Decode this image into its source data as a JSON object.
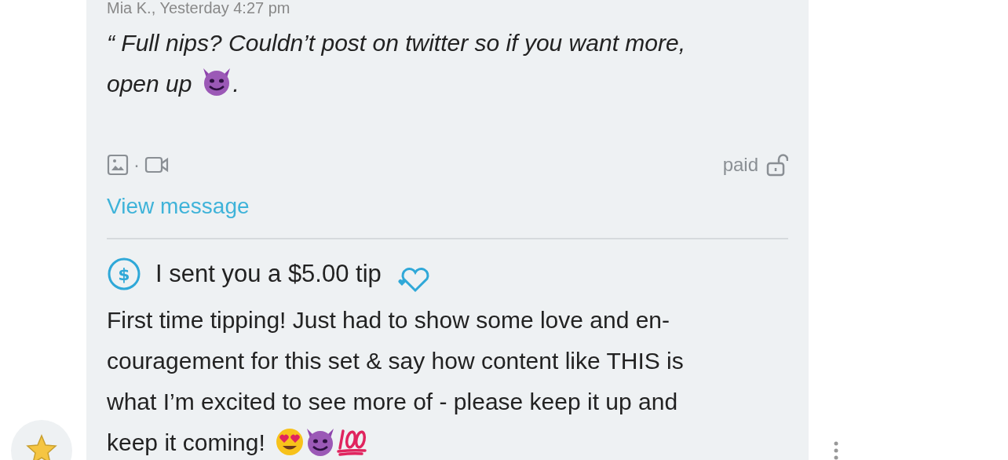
{
  "message": {
    "sender_line": "Mia K., Yesterday 4:27 pm",
    "quote_lines": [
      "“ Full nips? Couldn’t post on twitter so if you want more,",
      "open up"
    ],
    "quote_end": ".",
    "media_separator": "·",
    "price_label": "paid",
    "locked": false,
    "view_link": "View message"
  },
  "tip": {
    "icon_glyph": "$",
    "title": "I sent you a $5.00 tip",
    "lines": [
      "First time tipping! Just had to show some love and en-",
      "couragement for this set & say how content like THIS is",
      "what I’m excited to see more of - please keep it up and",
      "keep it coming!"
    ]
  }
}
